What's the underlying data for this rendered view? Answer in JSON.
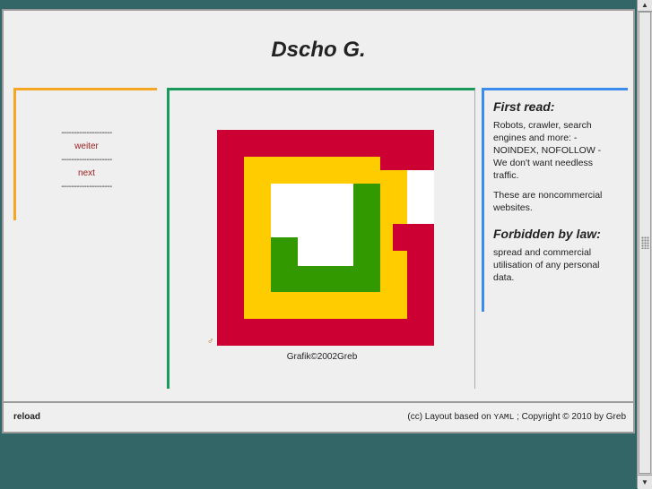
{
  "header": {
    "title": "Dscho G."
  },
  "nav": {
    "separator": "--------------------",
    "items": [
      {
        "label": "weiter"
      },
      {
        "label": "next"
      }
    ]
  },
  "main": {
    "graphic_caption": "Grafik©2002Greb",
    "graphic_icon": "male-symbol-icon",
    "graphic_colors": [
      "#cc0033",
      "#ffcc00",
      "#339900",
      "#ffffff"
    ]
  },
  "sidebar": {
    "first_read_title": "First read:",
    "first_read_text": "Robots, crawler, search engines and more: - NOINDEX, NOFOLLOW - We don't want needless traffic.",
    "noncommercial_text": "These are noncommercial websites.",
    "forbidden_title": "Forbidden by law:",
    "forbidden_text": "spread and commercial utilisation of any personal data."
  },
  "footer": {
    "reload_label": "reload",
    "credit_prefix": "(cc) Layout based on",
    "credit_yaml": "YAML",
    "credit_suffix": "; Copyright © 2010 by Greb"
  },
  "colors": {
    "background": "#336666",
    "left_accent": "#f5a623",
    "center_accent": "#1a9a5a",
    "right_accent": "#3c8cf0",
    "link": "#9b1c1c"
  }
}
